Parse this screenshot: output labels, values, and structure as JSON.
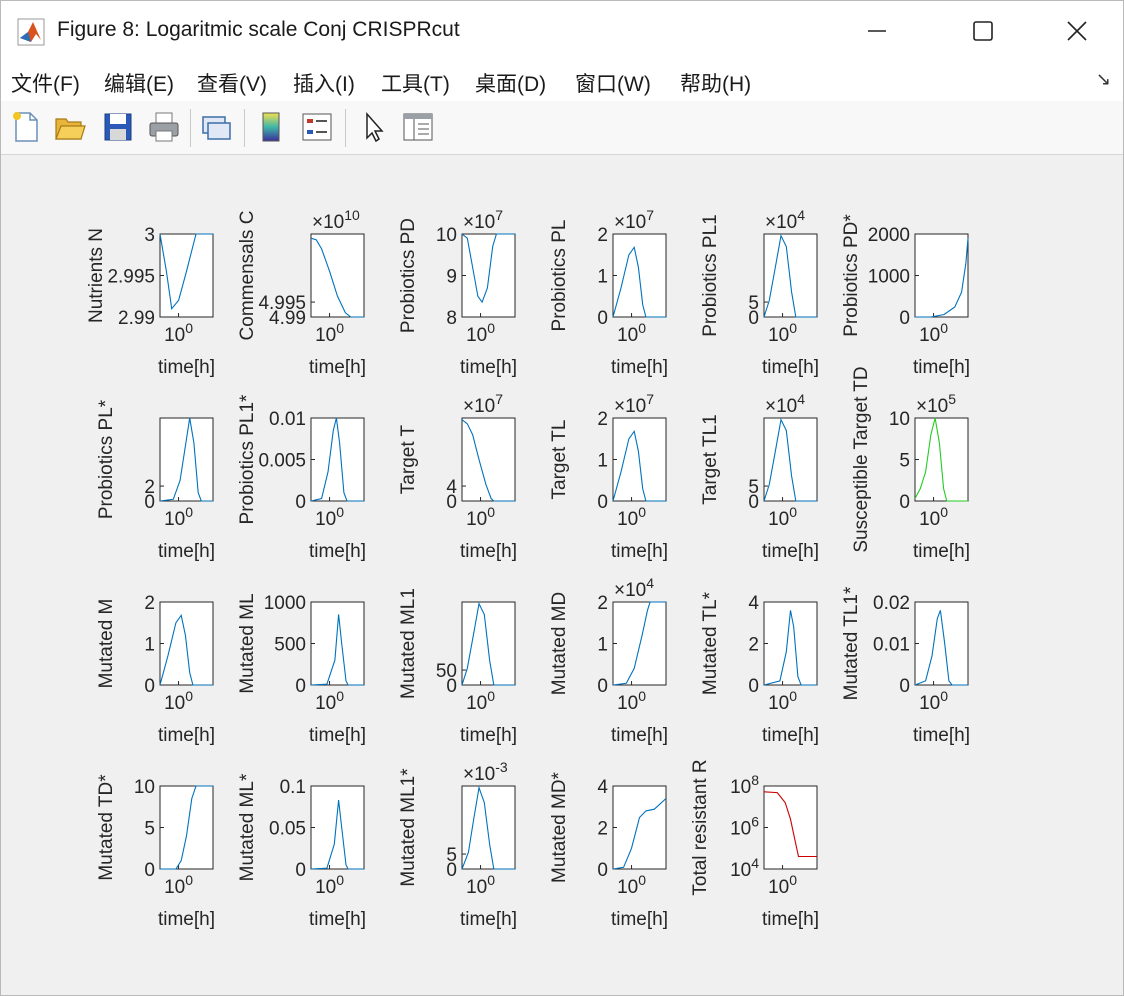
{
  "window": {
    "title": "Figure 8: Logaritmic scale Conj CRISPRcut",
    "minimize_icon": "minimize-icon",
    "maximize_icon": "maximize-icon",
    "close_icon": "close-icon"
  },
  "menu": [
    "文件(F)",
    "编辑(E)",
    "查看(V)",
    "插入(I)",
    "工具(T)",
    "桌面(D)",
    "窗口(W)",
    "帮助(H)"
  ],
  "toolbar": [
    "new-figure-icon",
    "open-file-icon",
    "save-icon",
    "print-icon",
    "link-icon",
    "colorbar-icon",
    "legend-icon",
    "pointer-icon",
    "property-inspector-icon"
  ],
  "colors": {
    "blue": "#0072bd",
    "green": "#22cc22",
    "red": "#cc0000"
  },
  "chart_data": [
    {
      "type": "line",
      "ylabel": "Nutrients N",
      "xlabel": "time[h]",
      "xtick": "10^0",
      "yticks": [
        "3",
        "2.995",
        "2.99"
      ],
      "multiplier": "",
      "color": "blue",
      "curve": [
        [
          0,
          1
        ],
        [
          0.12,
          0.55
        ],
        [
          0.22,
          0.1
        ],
        [
          0.35,
          0.2
        ],
        [
          0.5,
          0.55
        ],
        [
          0.68,
          1
        ],
        [
          1,
          1
        ]
      ]
    },
    {
      "type": "line",
      "ylabel": "Commensals C",
      "xlabel": "time[h]",
      "xtick": "10^0",
      "yticks": [
        "4.995",
        "4.99"
      ],
      "multiplier": "×10^10",
      "color": "blue",
      "curve": [
        [
          0,
          0.95
        ],
        [
          0.1,
          0.93
        ],
        [
          0.2,
          0.82
        ],
        [
          0.35,
          0.55
        ],
        [
          0.5,
          0.25
        ],
        [
          0.65,
          0.05
        ],
        [
          0.75,
          0
        ],
        [
          1,
          0
        ]
      ]
    },
    {
      "type": "line",
      "ylabel": "Probiotics PD",
      "xlabel": "time[h]",
      "xtick": "10^0",
      "yticks": [
        "10",
        "9",
        "8"
      ],
      "multiplier": "×10^7",
      "color": "blue",
      "curve": [
        [
          0,
          1
        ],
        [
          0.1,
          0.95
        ],
        [
          0.2,
          0.6
        ],
        [
          0.3,
          0.25
        ],
        [
          0.38,
          0.18
        ],
        [
          0.48,
          0.35
        ],
        [
          0.58,
          0.85
        ],
        [
          0.65,
          1
        ],
        [
          1,
          1
        ]
      ]
    },
    {
      "type": "line",
      "ylabel": "Probiotics PL",
      "xlabel": "time[h]",
      "xtick": "10^0",
      "yticks": [
        "2",
        "1",
        "0"
      ],
      "multiplier": "×10^7",
      "color": "blue",
      "curve": [
        [
          0,
          0
        ],
        [
          0.15,
          0.35
        ],
        [
          0.3,
          0.75
        ],
        [
          0.4,
          0.84
        ],
        [
          0.48,
          0.6
        ],
        [
          0.56,
          0.15
        ],
        [
          0.62,
          0
        ],
        [
          1,
          0
        ]
      ]
    },
    {
      "type": "line",
      "ylabel": "Probiotics PL1",
      "xlabel": "time[h]",
      "xtick": "10^0",
      "yticks": [
        "5",
        "0"
      ],
      "multiplier": "×10^4",
      "color": "blue",
      "curve": [
        [
          0,
          0
        ],
        [
          0.1,
          0.2
        ],
        [
          0.2,
          0.55
        ],
        [
          0.32,
          0.98
        ],
        [
          0.42,
          0.85
        ],
        [
          0.52,
          0.3
        ],
        [
          0.6,
          0
        ],
        [
          1,
          0
        ]
      ]
    },
    {
      "type": "line",
      "ylabel": "Probiotics PD*",
      "xlabel": "time[h]",
      "xtick": "10^0",
      "yticks": [
        "2000",
        "1000",
        "0"
      ],
      "multiplier": "",
      "color": "blue",
      "curve": [
        [
          0,
          0
        ],
        [
          0.3,
          0
        ],
        [
          0.55,
          0.03
        ],
        [
          0.75,
          0.12
        ],
        [
          0.88,
          0.3
        ],
        [
          0.96,
          0.65
        ],
        [
          1,
          0.95
        ]
      ]
    },
    {
      "type": "line",
      "ylabel": "Probiotics PL*",
      "xlabel": "time[h]",
      "xtick": "10^0",
      "yticks": [
        "2",
        "0"
      ],
      "multiplier": "",
      "color": "blue",
      "curve": [
        [
          0,
          0
        ],
        [
          0.25,
          0.02
        ],
        [
          0.38,
          0.25
        ],
        [
          0.5,
          0.75
        ],
        [
          0.56,
          1
        ],
        [
          0.64,
          0.7
        ],
        [
          0.72,
          0.1
        ],
        [
          0.78,
          0
        ],
        [
          1,
          0
        ]
      ]
    },
    {
      "type": "line",
      "ylabel": "Probiotics PL1*",
      "xlabel": "time[h]",
      "xtick": "10^0",
      "yticks": [
        "0.01",
        "0.005",
        "0"
      ],
      "multiplier": "",
      "color": "blue",
      "curve": [
        [
          0,
          0
        ],
        [
          0.2,
          0.03
        ],
        [
          0.32,
          0.35
        ],
        [
          0.42,
          0.85
        ],
        [
          0.48,
          1
        ],
        [
          0.54,
          0.7
        ],
        [
          0.62,
          0.1
        ],
        [
          0.68,
          0
        ],
        [
          1,
          0
        ]
      ]
    },
    {
      "type": "line",
      "ylabel": "Target T",
      "xlabel": "time[h]",
      "xtick": "10^0",
      "yticks": [
        "4",
        "0"
      ],
      "multiplier": "×10^7",
      "color": "blue",
      "curve": [
        [
          0,
          0.98
        ],
        [
          0.1,
          0.93
        ],
        [
          0.2,
          0.8
        ],
        [
          0.32,
          0.5
        ],
        [
          0.45,
          0.2
        ],
        [
          0.55,
          0.03
        ],
        [
          0.6,
          0
        ],
        [
          1,
          0
        ]
      ]
    },
    {
      "type": "line",
      "ylabel": "Target TL",
      "xlabel": "time[h]",
      "xtick": "10^0",
      "yticks": [
        "2",
        "1",
        "0"
      ],
      "multiplier": "×10^7",
      "color": "blue",
      "curve": [
        [
          0,
          0
        ],
        [
          0.15,
          0.35
        ],
        [
          0.3,
          0.75
        ],
        [
          0.4,
          0.84
        ],
        [
          0.48,
          0.6
        ],
        [
          0.56,
          0.15
        ],
        [
          0.62,
          0
        ],
        [
          1,
          0
        ]
      ]
    },
    {
      "type": "line",
      "ylabel": "Target TL1",
      "xlabel": "time[h]",
      "xtick": "10^0",
      "yticks": [
        "5",
        "0"
      ],
      "multiplier": "×10^4",
      "color": "blue",
      "curve": [
        [
          0,
          0
        ],
        [
          0.1,
          0.2
        ],
        [
          0.2,
          0.55
        ],
        [
          0.32,
          0.98
        ],
        [
          0.42,
          0.85
        ],
        [
          0.52,
          0.3
        ],
        [
          0.6,
          0
        ],
        [
          1,
          0
        ]
      ]
    },
    {
      "type": "line",
      "ylabel": "Susceptible Target TD",
      "xlabel": "time[h]",
      "xtick": "10^0",
      "yticks": [
        "10",
        "5",
        "0"
      ],
      "multiplier": "×10^5",
      "color": "green",
      "curve": [
        [
          0,
          0.03
        ],
        [
          0.1,
          0.15
        ],
        [
          0.2,
          0.35
        ],
        [
          0.3,
          0.8
        ],
        [
          0.38,
          1
        ],
        [
          0.46,
          0.7
        ],
        [
          0.54,
          0.15
        ],
        [
          0.6,
          0
        ],
        [
          1,
          0
        ]
      ]
    },
    {
      "type": "line",
      "ylabel": "Mutated M",
      "xlabel": "time[h]",
      "xtick": "10^0",
      "yticks": [
        "2",
        "1",
        "0"
      ],
      "multiplier": "",
      "color": "blue",
      "curve": [
        [
          0,
          0
        ],
        [
          0.15,
          0.35
        ],
        [
          0.3,
          0.75
        ],
        [
          0.4,
          0.84
        ],
        [
          0.48,
          0.6
        ],
        [
          0.56,
          0.15
        ],
        [
          0.62,
          0
        ],
        [
          1,
          0
        ]
      ]
    },
    {
      "type": "line",
      "ylabel": "Mutated ML",
      "xlabel": "time[h]",
      "xtick": "10^0",
      "yticks": [
        "1000",
        "500",
        "0"
      ],
      "multiplier": "",
      "color": "blue",
      "curve": [
        [
          0,
          0
        ],
        [
          0.3,
          0.01
        ],
        [
          0.45,
          0.3
        ],
        [
          0.52,
          0.85
        ],
        [
          0.58,
          0.5
        ],
        [
          0.66,
          0.05
        ],
        [
          0.7,
          0
        ],
        [
          1,
          0
        ]
      ]
    },
    {
      "type": "line",
      "ylabel": "Mutated ML1",
      "xlabel": "time[h]",
      "xtick": "10^0",
      "yticks": [
        "50",
        "0"
      ],
      "multiplier": "",
      "color": "blue",
      "curve": [
        [
          0,
          0
        ],
        [
          0.1,
          0.2
        ],
        [
          0.2,
          0.55
        ],
        [
          0.32,
          0.98
        ],
        [
          0.42,
          0.85
        ],
        [
          0.52,
          0.3
        ],
        [
          0.6,
          0
        ],
        [
          1,
          0
        ]
      ]
    },
    {
      "type": "line",
      "ylabel": "Mutated MD",
      "xlabel": "time[h]",
      "xtick": "10^0",
      "yticks": [
        "2",
        "1",
        "0"
      ],
      "multiplier": "×10^4",
      "color": "blue",
      "curve": [
        [
          0,
          0
        ],
        [
          0.25,
          0.02
        ],
        [
          0.4,
          0.2
        ],
        [
          0.55,
          0.6
        ],
        [
          0.65,
          0.9
        ],
        [
          0.7,
          1
        ],
        [
          1,
          1
        ]
      ]
    },
    {
      "type": "line",
      "ylabel": "Mutated TL*",
      "xlabel": "time[h]",
      "xtick": "10^0",
      "yticks": [
        "4",
        "2",
        "0"
      ],
      "multiplier": "",
      "color": "blue",
      "curve": [
        [
          0,
          0
        ],
        [
          0.3,
          0.05
        ],
        [
          0.42,
          0.4
        ],
        [
          0.5,
          0.9
        ],
        [
          0.56,
          0.7
        ],
        [
          0.64,
          0.1
        ],
        [
          0.7,
          0
        ],
        [
          1,
          0
        ]
      ]
    },
    {
      "type": "line",
      "ylabel": "Mutated TL1*",
      "xlabel": "time[h]",
      "xtick": "10^0",
      "yticks": [
        "0.02",
        "0.01",
        "0"
      ],
      "multiplier": "",
      "color": "blue",
      "curve": [
        [
          0,
          0
        ],
        [
          0.2,
          0.05
        ],
        [
          0.32,
          0.35
        ],
        [
          0.42,
          0.8
        ],
        [
          0.48,
          0.9
        ],
        [
          0.56,
          0.5
        ],
        [
          0.64,
          0.05
        ],
        [
          0.7,
          0
        ],
        [
          1,
          0
        ]
      ]
    },
    {
      "type": "line",
      "ylabel": "Mutated TD*",
      "xlabel": "time[h]",
      "xtick": "10^0",
      "yticks": [
        "10",
        "5",
        "0"
      ],
      "multiplier": "",
      "color": "blue",
      "curve": [
        [
          0,
          0
        ],
        [
          0.3,
          0
        ],
        [
          0.4,
          0.1
        ],
        [
          0.5,
          0.4
        ],
        [
          0.6,
          0.85
        ],
        [
          0.68,
          1
        ],
        [
          1,
          1
        ]
      ]
    },
    {
      "type": "line",
      "ylabel": "Mutated ML*",
      "xlabel": "time[h]",
      "xtick": "10^0",
      "yticks": [
        "0.1",
        "0.05",
        "0"
      ],
      "multiplier": "",
      "color": "blue",
      "curve": [
        [
          0,
          0
        ],
        [
          0.3,
          0.01
        ],
        [
          0.44,
          0.3
        ],
        [
          0.52,
          0.83
        ],
        [
          0.58,
          0.5
        ],
        [
          0.66,
          0.05
        ],
        [
          0.7,
          0
        ],
        [
          1,
          0
        ]
      ]
    },
    {
      "type": "line",
      "ylabel": "Mutated ML1*",
      "xlabel": "time[h]",
      "xtick": "10^0",
      "yticks": [
        "5",
        "0"
      ],
      "multiplier": "×10^-3",
      "color": "blue",
      "curve": [
        [
          0,
          0
        ],
        [
          0.12,
          0.2
        ],
        [
          0.22,
          0.6
        ],
        [
          0.32,
          0.98
        ],
        [
          0.42,
          0.8
        ],
        [
          0.52,
          0.3
        ],
        [
          0.6,
          0
        ],
        [
          1,
          0
        ]
      ]
    },
    {
      "type": "line",
      "ylabel": "Mutated MD*",
      "xlabel": "time[h]",
      "xtick": "10^0",
      "yticks": [
        "4",
        "2",
        "0"
      ],
      "multiplier": "",
      "color": "blue",
      "curve": [
        [
          0,
          0
        ],
        [
          0.2,
          0.02
        ],
        [
          0.35,
          0.25
        ],
        [
          0.5,
          0.62
        ],
        [
          0.62,
          0.7
        ],
        [
          0.78,
          0.72
        ],
        [
          1,
          0.85
        ]
      ]
    },
    {
      "type": "line",
      "ylabel": "Total resistant R",
      "xlabel": "time[h]",
      "xtick": "10^0",
      "yticks": [
        "10^8",
        "10^6",
        "10^4"
      ],
      "multiplier": "",
      "color": "red",
      "log": true,
      "curve": [
        [
          0,
          0.93
        ],
        [
          0.25,
          0.92
        ],
        [
          0.4,
          0.8
        ],
        [
          0.5,
          0.6
        ],
        [
          0.6,
          0.3
        ],
        [
          0.65,
          0.15
        ],
        [
          0.7,
          0.15
        ],
        [
          1,
          0.15
        ]
      ]
    }
  ]
}
